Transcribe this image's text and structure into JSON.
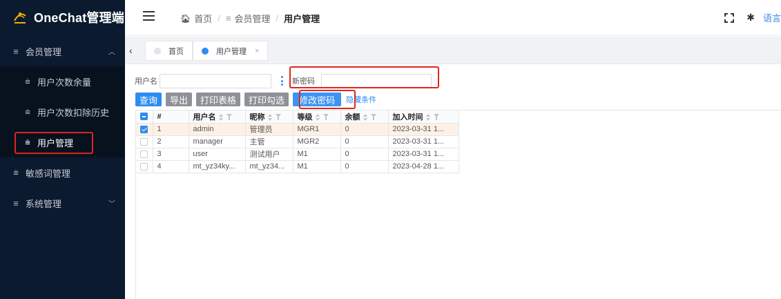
{
  "app": {
    "title": "OneChat管理端"
  },
  "colors": {
    "sidebar_bg": "#0b1a2e",
    "accent": "#2d8cf0",
    "highlight_box": "#e0241d",
    "selected_row": "#fdf1e5"
  },
  "sidebar": {
    "items": [
      {
        "label": "会员管理",
        "icon": "menu-lines-icon",
        "expanded": true
      },
      {
        "label": "用户次数余量",
        "icon": "filter-lines-icon"
      },
      {
        "label": "用户次数扣除历史",
        "icon": "filter-lines-icon"
      },
      {
        "label": "用户管理",
        "icon": "filter-lines-icon",
        "active": true
      },
      {
        "label": "敏感词管理",
        "icon": "filter-lines-icon"
      },
      {
        "label": "系统管理",
        "icon": "menu-lines-icon",
        "expanded": false
      }
    ]
  },
  "header": {
    "breadcrumb": {
      "home": "首页",
      "parent": "会员管理",
      "current": "用户管理"
    },
    "lang_label": "语言"
  },
  "tabs": [
    {
      "label": "首页",
      "active": false
    },
    {
      "label": "用户管理",
      "active": true,
      "close": "×"
    }
  ],
  "search": {
    "username_label": "用户名",
    "username_value": "",
    "new_password_label": "新密码",
    "new_password_value": ""
  },
  "toolbar": {
    "query": "查询",
    "export": "导出",
    "print_table": "打印表格",
    "print_checked": "打印勾选",
    "change_password": "修改密码",
    "hide_conditions": "隐藏条件"
  },
  "table": {
    "columns": [
      "#",
      "用户名",
      "昵称",
      "等级",
      "余额",
      "加入时间"
    ],
    "rows": [
      {
        "num": "1",
        "username": "admin",
        "nickname": "管理员",
        "level": "MGR1",
        "balance": "0",
        "joined": "2023-03-31 1...",
        "checked": true
      },
      {
        "num": "2",
        "username": "manager",
        "nickname": "主管",
        "level": "MGR2",
        "balance": "0",
        "joined": "2023-03-31 1...",
        "checked": false
      },
      {
        "num": "3",
        "username": "user",
        "nickname": "测试用户",
        "level": "M1",
        "balance": "0",
        "joined": "2023-03-31 1...",
        "checked": false
      },
      {
        "num": "4",
        "username": "mt_yz34ky...",
        "nickname": "mt_yz34...",
        "level": "M1",
        "balance": "0",
        "joined": "2023-04-28 1...",
        "checked": false
      }
    ]
  }
}
